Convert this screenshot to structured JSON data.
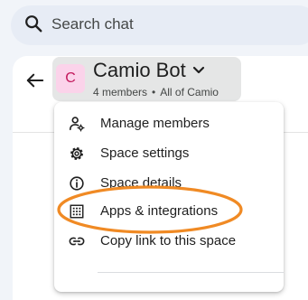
{
  "search": {
    "placeholder": "Search chat",
    "icon": "search-icon"
  },
  "header": {
    "back_icon": "arrow-back-icon",
    "avatar_letter": "C",
    "title": "Camio Bot",
    "members": "4 members",
    "separator": "•",
    "org": "All of Camio",
    "dropdown_icon": "chevron-down-icon"
  },
  "menu": {
    "items": [
      {
        "label": "Manage members",
        "icon": "manage-members-icon"
      },
      {
        "label": "Space settings",
        "icon": "gear-icon"
      },
      {
        "label": "Space details",
        "icon": "info-icon"
      },
      {
        "label": "Apps & integrations",
        "icon": "apps-grid-icon"
      },
      {
        "label": "Copy link to this space",
        "icon": "link-icon"
      }
    ],
    "highlighted_item": "Apps & integrations"
  },
  "colors": {
    "highlight_stroke": "#f08a24",
    "avatar_bg": "#fbd3ea",
    "avatar_text": "#c2185b",
    "page_bg": "#f1f4f9"
  }
}
